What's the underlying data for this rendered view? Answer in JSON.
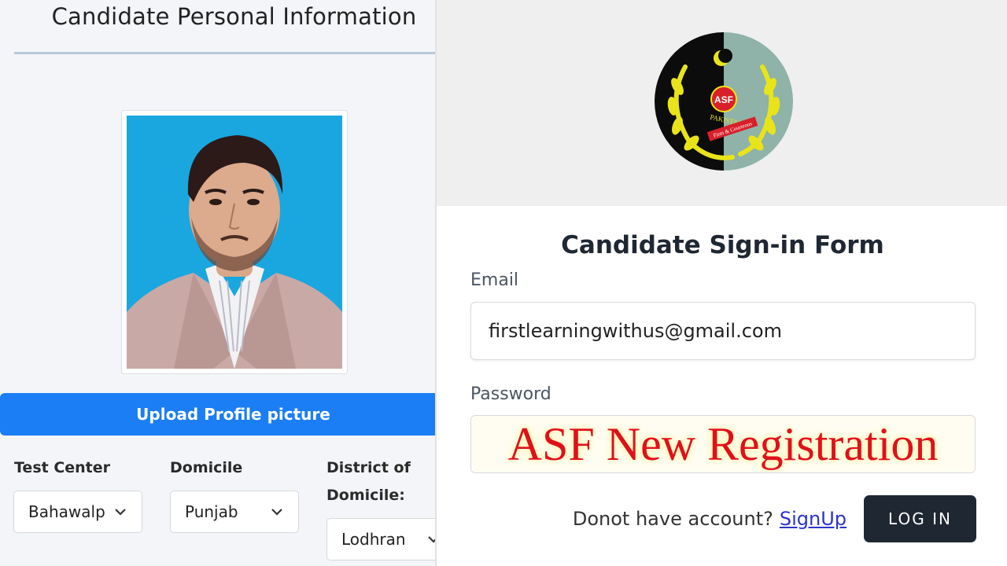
{
  "left_panel": {
    "title": "Candidate Personal Information",
    "upload_button_label": "Upload Profile picture",
    "fields": {
      "test_center": {
        "label": "Test Center",
        "value": "Bahawalp"
      },
      "domicile": {
        "label": "Domicile",
        "value": "Punjab"
      },
      "district": {
        "label_line1": "District of",
        "label_line2": "Domicile:",
        "value": "Lodhran"
      }
    }
  },
  "right_panel": {
    "logo": {
      "name": "asf-logo-icon",
      "text_asf": "ASF",
      "text_pakistan": "PAKISTAN",
      "text_motto": "Firm & Courteous"
    },
    "form_title": "Candidate Sign-in Form",
    "email": {
      "label": "Email",
      "value": "firstlearningwithus@gmail.com"
    },
    "password": {
      "label": "Password",
      "overlay_text": "ASF New Registration"
    },
    "footer": {
      "no_account_text": "Donot have account?",
      "signup_link": "SignUp",
      "login_button": "LOG IN"
    }
  },
  "colors": {
    "upload_button": "#1b7ef5",
    "login_button": "#1f2733",
    "banner_text": "#e0101a",
    "signup_link": "#2b34c9"
  }
}
